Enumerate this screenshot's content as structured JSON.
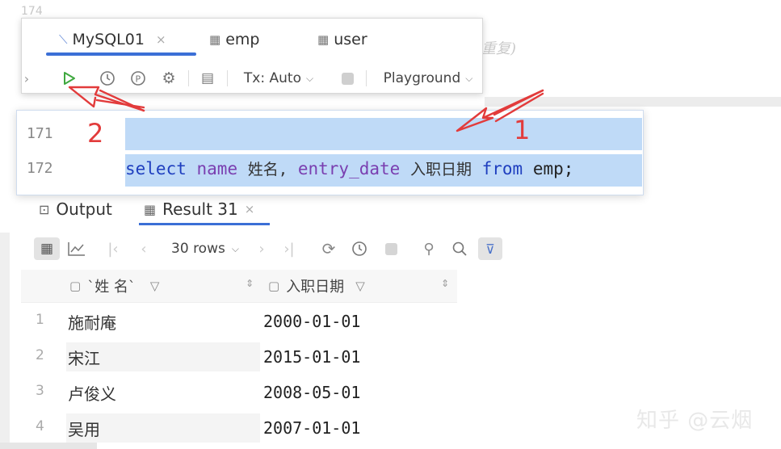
{
  "background": {
    "line_number": "174",
    "faded_text": "重复)"
  },
  "tabs": [
    {
      "label": "MySQL01",
      "icon": "console-icon",
      "active": true,
      "close": "×"
    },
    {
      "label": "emp",
      "icon": "table-icon"
    },
    {
      "label": "user",
      "icon": "table-icon"
    }
  ],
  "toolbar": {
    "tx_label": "Tx: Auto",
    "playground_label": "Playground"
  },
  "editor": {
    "lines": [
      {
        "number": "171"
      },
      {
        "number": "172"
      }
    ],
    "code": {
      "select": "select",
      "name": "name",
      "alias1": "姓名,",
      "entry_date": "entry_date",
      "alias2": "入职日期",
      "from": "from",
      "table": "emp;"
    }
  },
  "annotations": {
    "label1": "1",
    "label2": "2",
    "accent": "#e23b3b"
  },
  "output_tabs": [
    {
      "label": "Output",
      "icon": "terminal-icon"
    },
    {
      "label": "Result 31",
      "icon": "table-icon",
      "active": true,
      "close": "×"
    }
  ],
  "results_toolbar": {
    "rows_label": "30 rows"
  },
  "grid": {
    "columns": [
      {
        "label": "`姓 名`"
      },
      {
        "label": "入职日期"
      }
    ],
    "rows": [
      {
        "n": "1",
        "name": "施耐庵",
        "date": "2000-01-01"
      },
      {
        "n": "2",
        "name": "宋江",
        "date": "2015-01-01"
      },
      {
        "n": "3",
        "name": "卢俊义",
        "date": "2008-05-01"
      },
      {
        "n": "4",
        "name": "吴用",
        "date": "2007-01-01"
      }
    ]
  },
  "watermark": "知乎 @云烟",
  "colors": {
    "accent_blue": "#3b6fd6",
    "selection": "#bfdaf7",
    "keyword": "#1f3fbf",
    "identifier": "#7a3fb0",
    "run_green": "#3fa83f"
  }
}
